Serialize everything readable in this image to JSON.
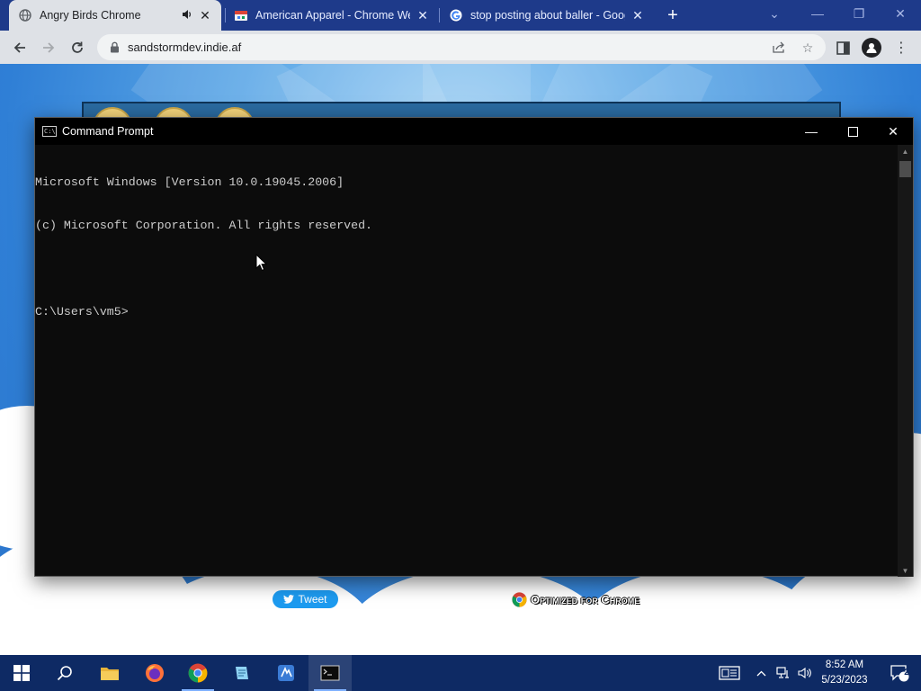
{
  "browser": {
    "tabs": [
      {
        "title": "Angry Birds Chrome",
        "favicon": "globe-icon",
        "audio": true,
        "active": true
      },
      {
        "title": "American Apparel - Chrome Web",
        "favicon": "store-icon",
        "active": false
      },
      {
        "title": "stop posting about baller - Goog",
        "favicon": "google-g-icon",
        "active": false
      }
    ],
    "new_tab_label": "+",
    "url": "sandstormdev.indie.af"
  },
  "page": {
    "tweet_label": "Tweet",
    "badge_label": "Optimized for Chrome"
  },
  "cmd": {
    "title": "Command Prompt",
    "lines": [
      "Microsoft Windows [Version 10.0.19045.2006]",
      "(c) Microsoft Corporation. All rights reserved.",
      "",
      "C:\\Users\\vm5>"
    ]
  },
  "taskbar": {
    "apps": [
      "start-icon",
      "search-icon",
      "file-explorer-icon",
      "firefox-icon",
      "chrome-icon",
      "notepad-icon",
      "edge-icon",
      "cmd-icon"
    ],
    "clock_time": "8:52 AM",
    "clock_date": "5/23/2023",
    "notification_count": "2"
  },
  "colors": {
    "tabstrip": "#1e3a8a",
    "toolbar": "#dee1e6",
    "cmd_bg": "#0c0c0c",
    "taskbar": "#0e2a64",
    "tweet": "#1d9bf0"
  }
}
